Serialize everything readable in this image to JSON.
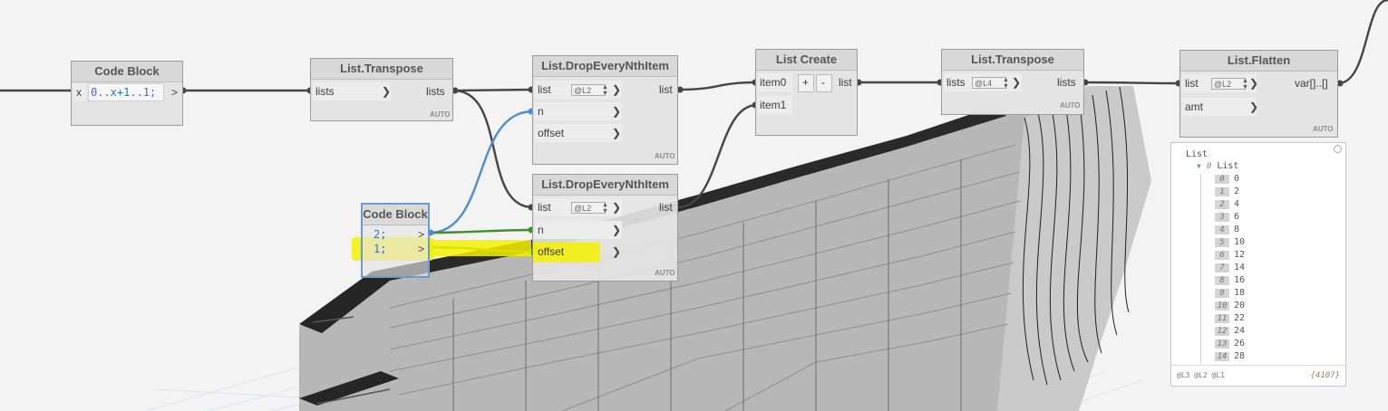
{
  "nodes": {
    "code_block_1": {
      "title": "Code Block",
      "in_label": "x",
      "code": "0..x+1..1;",
      "out_arrow": ">"
    },
    "transpose_1": {
      "title": "List.Transpose",
      "in_label": "lists",
      "out_label": "lists",
      "auto": "AUTO"
    },
    "drop_1": {
      "title": "List.DropEveryNthItem",
      "ports": [
        "list",
        "n",
        "offset"
      ],
      "lacing": "@L2",
      "out_label": "list",
      "auto": "AUTO"
    },
    "drop_2": {
      "title": "List.DropEveryNthItem",
      "ports": [
        "list",
        "n",
        "offset"
      ],
      "lacing": "@L2",
      "out_label": "list",
      "auto": "AUTO"
    },
    "code_block_2": {
      "title": "Code Block",
      "lines": [
        "2;",
        "1;"
      ],
      "out_arrow": ">"
    },
    "list_create": {
      "title": "List Create",
      "ports": [
        "item0",
        "item1"
      ],
      "plus": "+",
      "minus": "-",
      "out_label": "list"
    },
    "transpose_2": {
      "title": "List.Transpose",
      "in_label": "lists",
      "lacing": "@L4",
      "out_label": "lists",
      "auto": "AUTO"
    },
    "flatten": {
      "title": "List.Flatten",
      "ports": [
        "list",
        "amt"
      ],
      "lacing": "@L2",
      "out_label": "var[]..[]",
      "auto": "AUTO"
    }
  },
  "preview": {
    "root": "List",
    "sub_index": "0",
    "sub_label": "List",
    "items": [
      {
        "i": "0",
        "v": "0"
      },
      {
        "i": "1",
        "v": "2"
      },
      {
        "i": "2",
        "v": "4"
      },
      {
        "i": "3",
        "v": "6"
      },
      {
        "i": "4",
        "v": "8"
      },
      {
        "i": "5",
        "v": "10"
      },
      {
        "i": "6",
        "v": "12"
      },
      {
        "i": "7",
        "v": "14"
      },
      {
        "i": "8",
        "v": "16"
      },
      {
        "i": "9",
        "v": "18"
      },
      {
        "i": "10",
        "v": "20"
      },
      {
        "i": "11",
        "v": "22"
      },
      {
        "i": "12",
        "v": "24"
      },
      {
        "i": "13",
        "v": "26"
      },
      {
        "i": "14",
        "v": "28"
      }
    ],
    "levels": "@L3 @L2 @L1",
    "count": "{4107}"
  },
  "colors": {
    "wire_dark": "#454545",
    "wire_blue": "#4a8fd0",
    "wire_green": "#3c8f2c",
    "highlight": "#f4f000"
  }
}
